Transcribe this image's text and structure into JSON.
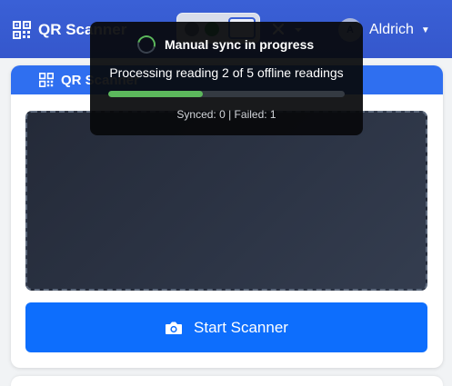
{
  "app": {
    "brand_label": "QR Scanner",
    "brand_icon": "qrcode-icon"
  },
  "navbar": {
    "tools_icon": "tools-icon",
    "user": {
      "name": "Aldrich",
      "avatar_initials": "A"
    }
  },
  "scanner_card": {
    "title": "QR Scanner",
    "title_icon": "qrcode-icon",
    "start_button_label": "Start Scanner",
    "start_button_icon": "camera-icon"
  },
  "sync_toast": {
    "title": "Manual sync in progress",
    "progress_text": "Processing reading 2 of 5 offline readings",
    "progress_fraction": 0.4,
    "stats_text": "Synced: 0 | Failed: 1"
  },
  "colors": {
    "navbar": "#3557cc",
    "card_header": "#2f6ff0",
    "primary_button": "#0d6efd",
    "progress": "#5cb85c",
    "toast_background": "#08090b"
  }
}
